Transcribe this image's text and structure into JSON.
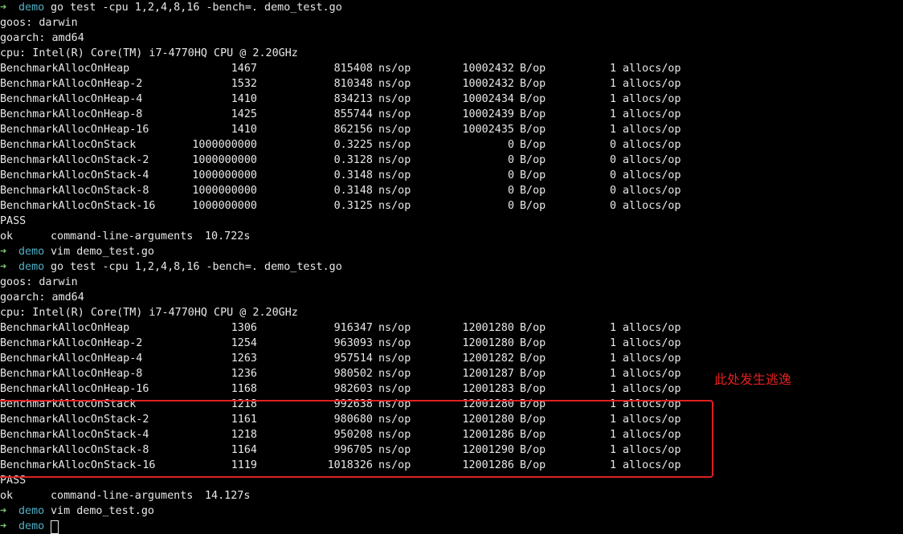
{
  "session": {
    "prompt_arrow": "➜",
    "prompt_dir": "demo",
    "commands": [
      "go test -cpu 1,2,4,8,16 -bench=. demo_test.go",
      "vim demo_test.go"
    ],
    "goos": "goos: darwin",
    "goarch": "goarch: amd64",
    "cpu": "cpu: Intel(R) Core(TM) i7-4770HQ CPU @ 2.20GHz",
    "pass": "PASS",
    "ok_label": "ok",
    "package": "command-line-arguments",
    "durations": [
      "10.722s",
      "14.127s"
    ]
  },
  "runs": [
    {
      "rows": [
        {
          "name": "BenchmarkAllocOnHeap",
          "iters": "1467",
          "ns": "815408",
          "ns_unit": "ns/op",
          "bytes": "10002432",
          "bytes_unit": "B/op",
          "allocs": "1",
          "allocs_unit": "allocs/op"
        },
        {
          "name": "BenchmarkAllocOnHeap-2",
          "iters": "1532",
          "ns": "810348",
          "ns_unit": "ns/op",
          "bytes": "10002432",
          "bytes_unit": "B/op",
          "allocs": "1",
          "allocs_unit": "allocs/op"
        },
        {
          "name": "BenchmarkAllocOnHeap-4",
          "iters": "1410",
          "ns": "834213",
          "ns_unit": "ns/op",
          "bytes": "10002434",
          "bytes_unit": "B/op",
          "allocs": "1",
          "allocs_unit": "allocs/op"
        },
        {
          "name": "BenchmarkAllocOnHeap-8",
          "iters": "1425",
          "ns": "855744",
          "ns_unit": "ns/op",
          "bytes": "10002439",
          "bytes_unit": "B/op",
          "allocs": "1",
          "allocs_unit": "allocs/op"
        },
        {
          "name": "BenchmarkAllocOnHeap-16",
          "iters": "1410",
          "ns": "862156",
          "ns_unit": "ns/op",
          "bytes": "10002435",
          "bytes_unit": "B/op",
          "allocs": "1",
          "allocs_unit": "allocs/op"
        },
        {
          "name": "BenchmarkAllocOnStack",
          "iters": "1000000000",
          "ns": "0.3225",
          "ns_unit": "ns/op",
          "bytes": "0",
          "bytes_unit": "B/op",
          "allocs": "0",
          "allocs_unit": "allocs/op"
        },
        {
          "name": "BenchmarkAllocOnStack-2",
          "iters": "1000000000",
          "ns": "0.3128",
          "ns_unit": "ns/op",
          "bytes": "0",
          "bytes_unit": "B/op",
          "allocs": "0",
          "allocs_unit": "allocs/op"
        },
        {
          "name": "BenchmarkAllocOnStack-4",
          "iters": "1000000000",
          "ns": "0.3148",
          "ns_unit": "ns/op",
          "bytes": "0",
          "bytes_unit": "B/op",
          "allocs": "0",
          "allocs_unit": "allocs/op"
        },
        {
          "name": "BenchmarkAllocOnStack-8",
          "iters": "1000000000",
          "ns": "0.3148",
          "ns_unit": "ns/op",
          "bytes": "0",
          "bytes_unit": "B/op",
          "allocs": "0",
          "allocs_unit": "allocs/op"
        },
        {
          "name": "BenchmarkAllocOnStack-16",
          "iters": "1000000000",
          "ns": "0.3125",
          "ns_unit": "ns/op",
          "bytes": "0",
          "bytes_unit": "B/op",
          "allocs": "0",
          "allocs_unit": "allocs/op"
        }
      ]
    },
    {
      "rows": [
        {
          "name": "BenchmarkAllocOnHeap",
          "iters": "1306",
          "ns": "916347",
          "ns_unit": "ns/op",
          "bytes": "12001280",
          "bytes_unit": "B/op",
          "allocs": "1",
          "allocs_unit": "allocs/op"
        },
        {
          "name": "BenchmarkAllocOnHeap-2",
          "iters": "1254",
          "ns": "963093",
          "ns_unit": "ns/op",
          "bytes": "12001280",
          "bytes_unit": "B/op",
          "allocs": "1",
          "allocs_unit": "allocs/op"
        },
        {
          "name": "BenchmarkAllocOnHeap-4",
          "iters": "1263",
          "ns": "957514",
          "ns_unit": "ns/op",
          "bytes": "12001282",
          "bytes_unit": "B/op",
          "allocs": "1",
          "allocs_unit": "allocs/op"
        },
        {
          "name": "BenchmarkAllocOnHeap-8",
          "iters": "1236",
          "ns": "980502",
          "ns_unit": "ns/op",
          "bytes": "12001287",
          "bytes_unit": "B/op",
          "allocs": "1",
          "allocs_unit": "allocs/op"
        },
        {
          "name": "BenchmarkAllocOnHeap-16",
          "iters": "1168",
          "ns": "982603",
          "ns_unit": "ns/op",
          "bytes": "12001283",
          "bytes_unit": "B/op",
          "allocs": "1",
          "allocs_unit": "allocs/op"
        },
        {
          "name": "BenchmarkAllocOnStack",
          "iters": "1218",
          "ns": "992638",
          "ns_unit": "ns/op",
          "bytes": "12001280",
          "bytes_unit": "B/op",
          "allocs": "1",
          "allocs_unit": "allocs/op"
        },
        {
          "name": "BenchmarkAllocOnStack-2",
          "iters": "1161",
          "ns": "980680",
          "ns_unit": "ns/op",
          "bytes": "12001280",
          "bytes_unit": "B/op",
          "allocs": "1",
          "allocs_unit": "allocs/op"
        },
        {
          "name": "BenchmarkAllocOnStack-4",
          "iters": "1218",
          "ns": "950208",
          "ns_unit": "ns/op",
          "bytes": "12001286",
          "bytes_unit": "B/op",
          "allocs": "1",
          "allocs_unit": "allocs/op"
        },
        {
          "name": "BenchmarkAllocOnStack-8",
          "iters": "1164",
          "ns": "996705",
          "ns_unit": "ns/op",
          "bytes": "12001290",
          "bytes_unit": "B/op",
          "allocs": "1",
          "allocs_unit": "allocs/op"
        },
        {
          "name": "BenchmarkAllocOnStack-16",
          "iters": "1119",
          "ns": "1018326",
          "ns_unit": "ns/op",
          "bytes": "12001286",
          "bytes_unit": "B/op",
          "allocs": "1",
          "allocs_unit": "allocs/op"
        }
      ]
    }
  ],
  "annotation": {
    "text": "此处发生逃逸",
    "color": "#e02020"
  },
  "colors": {
    "background": "#000000",
    "text": "#e8e8e8",
    "prompt_arrow": "#7bc96f",
    "prompt_dir": "#4fb0c6"
  }
}
